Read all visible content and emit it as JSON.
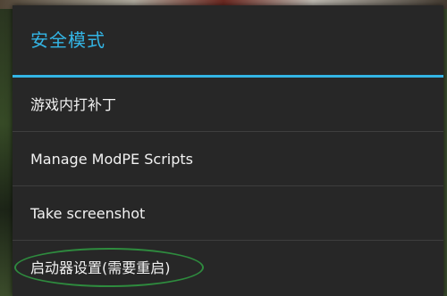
{
  "dialog": {
    "title": "安全模式",
    "accent_color": "#33b5e5",
    "background_color": "#272727",
    "items": [
      {
        "label": "游戏内打补丁"
      },
      {
        "label": "Manage ModPE Scripts"
      },
      {
        "label": "Take screenshot"
      },
      {
        "label": "启动器设置(需要重启)"
      }
    ]
  },
  "annotation": {
    "highlighted_item": "启动器设置(需要重启)",
    "color": "#2e8b3e"
  }
}
